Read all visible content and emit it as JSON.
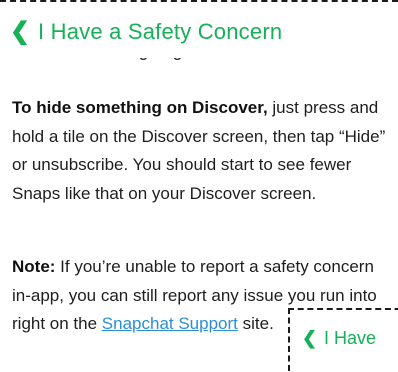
{
  "header": {
    "back_icon": "chevron-left-icon",
    "back_glyph": "❮",
    "title": "I Have a Safety Concern"
  },
  "content": {
    "partial_line": "us know what's going on.",
    "paragraph1": {
      "bold": "To hide something on Discover,",
      "text": " just press and hold a tile on the Discover screen, then tap “Hide” or unsubscribe. You should start to see fewer Snaps like that on your Discover screen."
    },
    "paragraph2": {
      "bold": "Note:",
      "text_before": " If you’re unable to report a safety concern in-app, you can still report any issue you run into right on the ",
      "link": "Snapchat Support",
      "text_after": " site."
    }
  },
  "thumbnail": {
    "chevron_glyph": "❮",
    "title": "I Have"
  },
  "colors": {
    "accent": "#16b157",
    "link": "#2a8fd6",
    "text": "#1e1e1e"
  }
}
